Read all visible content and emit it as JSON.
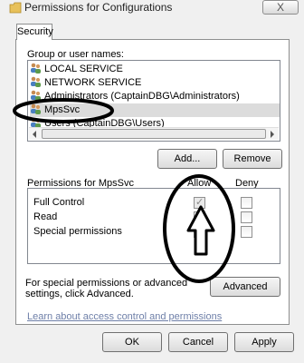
{
  "window": {
    "title": "Permissions for Configurations",
    "close_label": "X"
  },
  "tabs": [
    {
      "label": "Security"
    }
  ],
  "group_list": {
    "label": "Group or user names:",
    "items": [
      {
        "name": "LOCAL SERVICE",
        "icon": "user-group-icon"
      },
      {
        "name": "NETWORK SERVICE",
        "icon": "user-group-icon"
      },
      {
        "name": "Administrators (CaptainDBG\\Administrators)",
        "icon": "user-group-icon"
      },
      {
        "name": "MpsSvc",
        "icon": "user-group-icon",
        "selected": true
      },
      {
        "name": "Users (CaptainDBG\\Users)",
        "icon": "user-group-icon"
      }
    ]
  },
  "buttons": {
    "add": "Add...",
    "remove": "Remove",
    "advanced": "Advanced",
    "ok": "OK",
    "cancel": "Cancel",
    "apply": "Apply"
  },
  "permissions": {
    "header": "Permissions for MpsSvc",
    "allow_label": "Allow",
    "deny_label": "Deny",
    "rows": [
      {
        "name": "Full Control",
        "allow": true,
        "deny": false
      },
      {
        "name": "Read",
        "allow": false,
        "deny": false
      },
      {
        "name": "Special permissions",
        "allow": false,
        "deny": false
      }
    ]
  },
  "advanced_text": "For special permissions or advanced settings, click Advanced.",
  "learn_link": "Learn about access control and permissions"
}
